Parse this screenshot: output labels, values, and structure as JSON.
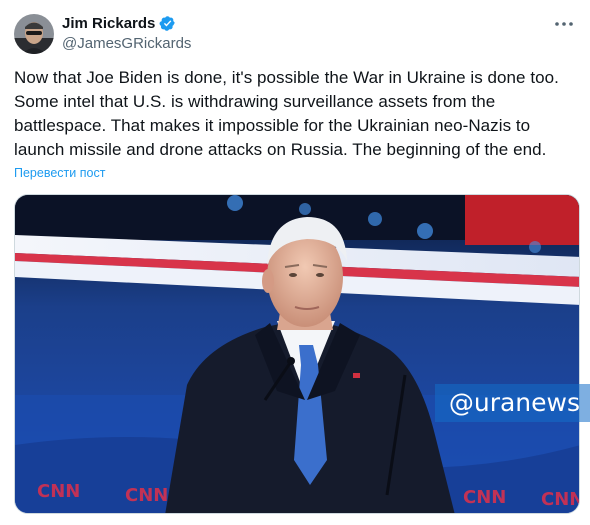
{
  "author": {
    "display_name": "Jim Rickards",
    "handle": "@JamesGRickards",
    "verified_icon": "verified-badge-icon",
    "avatar": "avatar-photo"
  },
  "tweet": {
    "text": "Now that Joe Biden is done, it's possible the War in Ukraine is done too. Some intel that U.S. is withdrawing surveillance assets from the battlespace. That makes it impossible for the Ukrainian neo-Nazis to launch missile and drone attacks on Russia. The beginning of the end.",
    "translate_label": "Перевести пост"
  },
  "media": {
    "watermark": "@uranews",
    "backdrop_logos": [
      "CNN",
      "CNN",
      "CNN",
      "CNN",
      "CNN"
    ]
  },
  "colors": {
    "accent": "#1d9bf0",
    "verified": "#1d9bf0",
    "text": "#0f1419",
    "secondary": "#536471"
  }
}
